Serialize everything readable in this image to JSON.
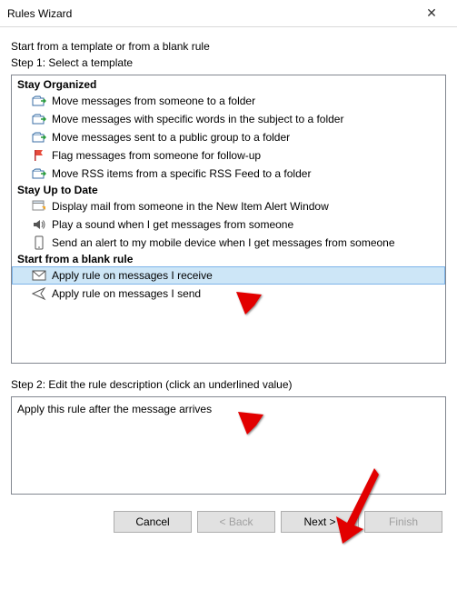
{
  "window": {
    "title": "Rules Wizard",
    "close_glyph": "✕"
  },
  "intro": "Start from a template or from a blank rule",
  "step1_label": "Step 1: Select a template",
  "sections": {
    "stay_organized": {
      "header": "Stay Organized",
      "items": [
        "Move messages from someone to a folder",
        "Move messages with specific words in the subject to a folder",
        "Move messages sent to a public group to a folder",
        "Flag messages from someone for follow-up",
        "Move RSS items from a specific RSS Feed to a folder"
      ]
    },
    "stay_up_to_date": {
      "header": "Stay Up to Date",
      "items": [
        "Display mail from someone in the New Item Alert Window",
        "Play a sound when I get messages from someone",
        "Send an alert to my mobile device when I get messages from someone"
      ]
    },
    "blank_rule": {
      "header": "Start from a blank rule",
      "items": [
        "Apply rule on messages I receive",
        "Apply rule on messages I send"
      ]
    }
  },
  "step2_label": "Step 2: Edit the rule description (click an underlined value)",
  "description": "Apply this rule after the message arrives",
  "buttons": {
    "cancel": "Cancel",
    "back": "< Back",
    "next": "Next >",
    "finish": "Finish"
  }
}
